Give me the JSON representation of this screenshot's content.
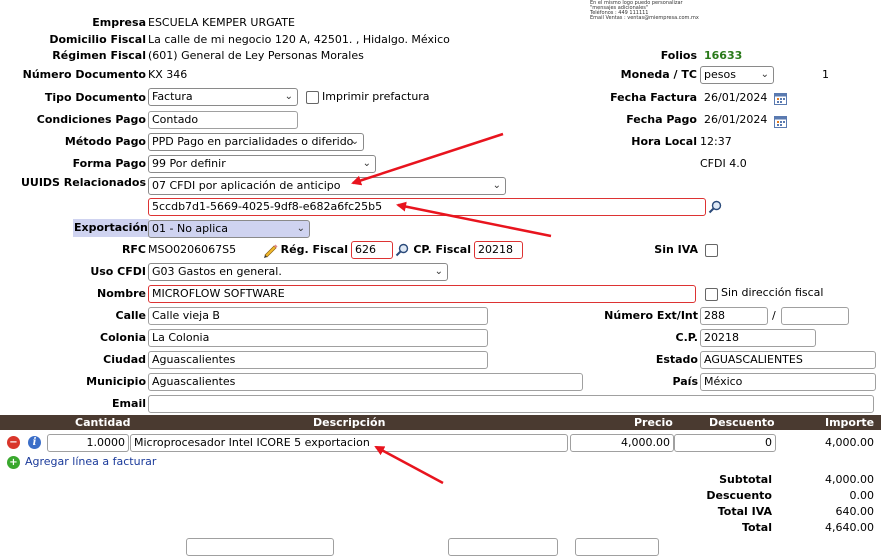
{
  "letterhead": {
    "line1": "En el mismo logo puedo personalizar",
    "line2": "\"mensajes adicionales\"",
    "line3": "Teléfonos : 449 111111",
    "line4": "Email Ventas : ventas@miempresa.com.mx"
  },
  "emisor": {
    "empresa_label": "Empresa",
    "empresa": "ESCUELA KEMPER URGATE",
    "domicilio_label": "Domicilio Fiscal",
    "domicilio": "La calle de mi negocio 120 A, 42501. , Hidalgo. México",
    "regimen_label": "Régimen Fiscal",
    "regimen": "(601) General de Ley Personas Morales"
  },
  "document": {
    "folios_label": "Folios",
    "folios": "16633",
    "numero_label": "Número Documento",
    "numero": "KX 346",
    "moneda_label": "Moneda / TC",
    "moneda": "pesos",
    "tc": "1",
    "tipo_label": "Tipo Documento",
    "tipo": "Factura",
    "imprimir_label": "Imprimir prefactura",
    "fecha_factura_label": "Fecha Factura",
    "fecha_factura": "26/01/2024",
    "condiciones_label": "Condiciones Pago",
    "condiciones": "Contado",
    "fecha_pago_label": "Fecha Pago",
    "fecha_pago": "26/01/2024",
    "metodo_label": "Método Pago",
    "metodo": "PPD Pago en parcialidades o diferido",
    "hora_label": "Hora Local",
    "hora": "12:37",
    "forma_label": "Forma Pago",
    "forma": "99 Por definir",
    "cfdi_version": "CFDI 4.0",
    "uuids_label": "UUIDS Relacionados",
    "uuids_tipo": "07 CFDI por aplicación de anticipo",
    "uuid_value": "5ccdb7d1-5669-4025-9df8-e682a6fc25b5",
    "exportacion_label": "Exportación",
    "exportacion": "01 - No aplica"
  },
  "receptor": {
    "rfc_label": "RFC",
    "rfc": "MSO0206067S5",
    "regimen_label": "Rég. Fiscal",
    "regimen": "626",
    "cp_fiscal_label": "CP. Fiscal",
    "cp_fiscal": "20218",
    "sin_iva_label": "Sin IVA",
    "uso_label": "Uso CFDI",
    "uso": "G03 Gastos en general.",
    "nombre_label": "Nombre",
    "nombre": "MICROFLOW SOFTWARE",
    "sin_direccion_label": "Sin dirección fiscal",
    "calle_label": "Calle",
    "calle": "Calle vieja B",
    "num_label": "Número Ext/Int",
    "num_ext": "288",
    "num_sep": "/",
    "num_int": "",
    "colonia_label": "Colonia",
    "colonia": "La Colonia",
    "cp_label": "C.P.",
    "cp": "20218",
    "ciudad_label": "Ciudad",
    "ciudad": "Aguascalientes",
    "estado_label": "Estado",
    "estado": "AGUASCALIENTES",
    "municipio_label": "Municipio",
    "municipio": "Aguascalientes",
    "pais_label": "País",
    "pais": "México",
    "email_label": "Email",
    "email": ""
  },
  "grid": {
    "headers": {
      "cantidad": "Cantidad",
      "descripcion": "Descripción",
      "precio": "Precio",
      "descuento": "Descuento",
      "importe": "Importe"
    },
    "rows": [
      {
        "cantidad": "1.0000",
        "descripcion": "Microprocesador Intel ICORE 5 exportacion",
        "precio": "4,000.00",
        "descuento": "0",
        "importe": "4,000.00"
      }
    ],
    "add_line": "Agregar línea a facturar"
  },
  "totals": {
    "subtotal_label": "Subtotal",
    "subtotal": "4,000.00",
    "descuento_label": "Descuento",
    "descuento": "0.00",
    "iva_label": "Total IVA",
    "iva": "640.00",
    "total_label": "Total",
    "total": "4,640.00"
  },
  "colors": {
    "arrow": "#e8141e",
    "grid_header": "#4a3a30",
    "folio": "#2a7a1a",
    "highlight": "#cfd3f0"
  }
}
